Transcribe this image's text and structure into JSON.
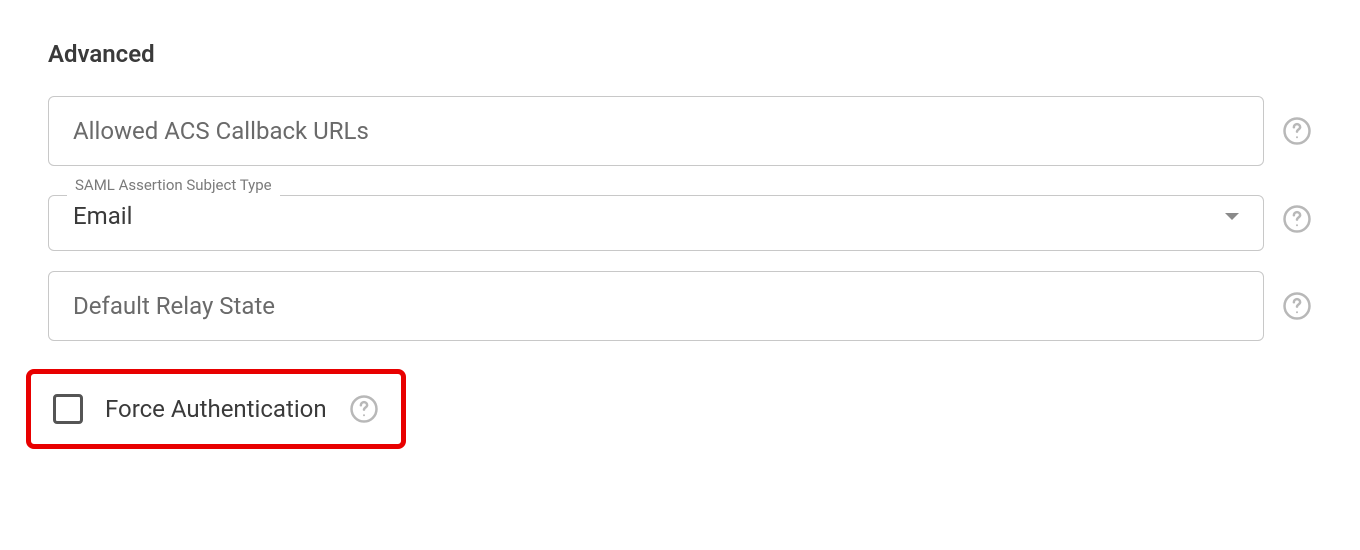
{
  "section": {
    "title": "Advanced"
  },
  "fields": {
    "acs_callback": {
      "placeholder": "Allowed ACS Callback URLs"
    },
    "assertion_type": {
      "label": "SAML Assertion Subject Type",
      "value": "Email"
    },
    "relay_state": {
      "placeholder": "Default Relay State"
    },
    "force_auth": {
      "label": "Force Authentication"
    }
  }
}
